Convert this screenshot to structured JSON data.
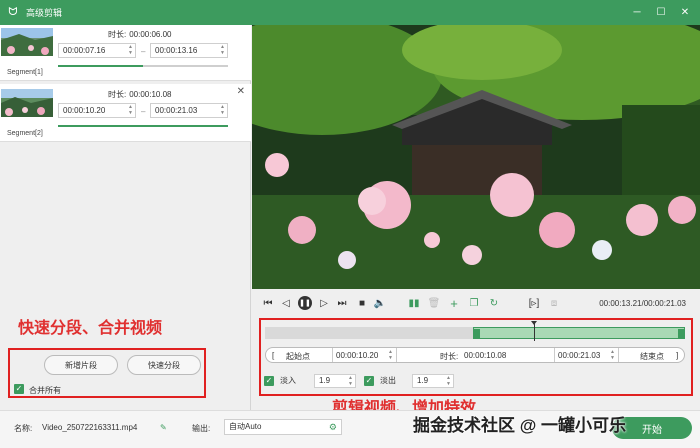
{
  "window": {
    "title": "高级剪辑",
    "minimize_glyph": "─",
    "maximize_glyph": "☐",
    "close_glyph": "✕"
  },
  "segments": [
    {
      "label": "Segment[1]",
      "duration_label": "时长:",
      "duration": "00:00:06.00",
      "start": "00:00:07.16",
      "end": "00:00:13.16",
      "progress": 0.5
    },
    {
      "label": "Segment[2]",
      "duration_label": "时长:",
      "duration": "00:00:10.08",
      "start": "00:00:10.20",
      "end": "00:00:21.03",
      "progress": 1.0
    }
  ],
  "left_actions": {
    "add_segment": "新增片段",
    "quick_split": "快速分段",
    "merge_all": "合并所有",
    "merge_all_checked": true
  },
  "annotations": {
    "left": "快速分段、合并视频",
    "right": "剪辑视频、增加特效"
  },
  "playback": {
    "current_time": "00:00:13.21",
    "total_time": "00:00:21.03",
    "separator": "/"
  },
  "range": {
    "start_label": "起始点",
    "start_value": "00:00:10.20",
    "duration_label": "时长:",
    "duration_value": "00:00:10.08",
    "end_value": "00:00:21.03",
    "end_label": "结束点"
  },
  "effects": {
    "fade_in_label": "淡入",
    "fade_in_value": "1.9",
    "fade_in_checked": true,
    "fade_out_label": "淡出",
    "fade_out_value": "1.9",
    "fade_out_checked": true
  },
  "footer": {
    "name_label": "名称:",
    "file_name": "Video_250722163311.mp4",
    "output_label": "输出:",
    "output_value": "自动Auto",
    "start_button": "开始"
  },
  "watermark": "掘金技术社区 @ 一罐小可乐",
  "colors": {
    "accent": "#3d9b5e",
    "annotation": "#e02020"
  }
}
